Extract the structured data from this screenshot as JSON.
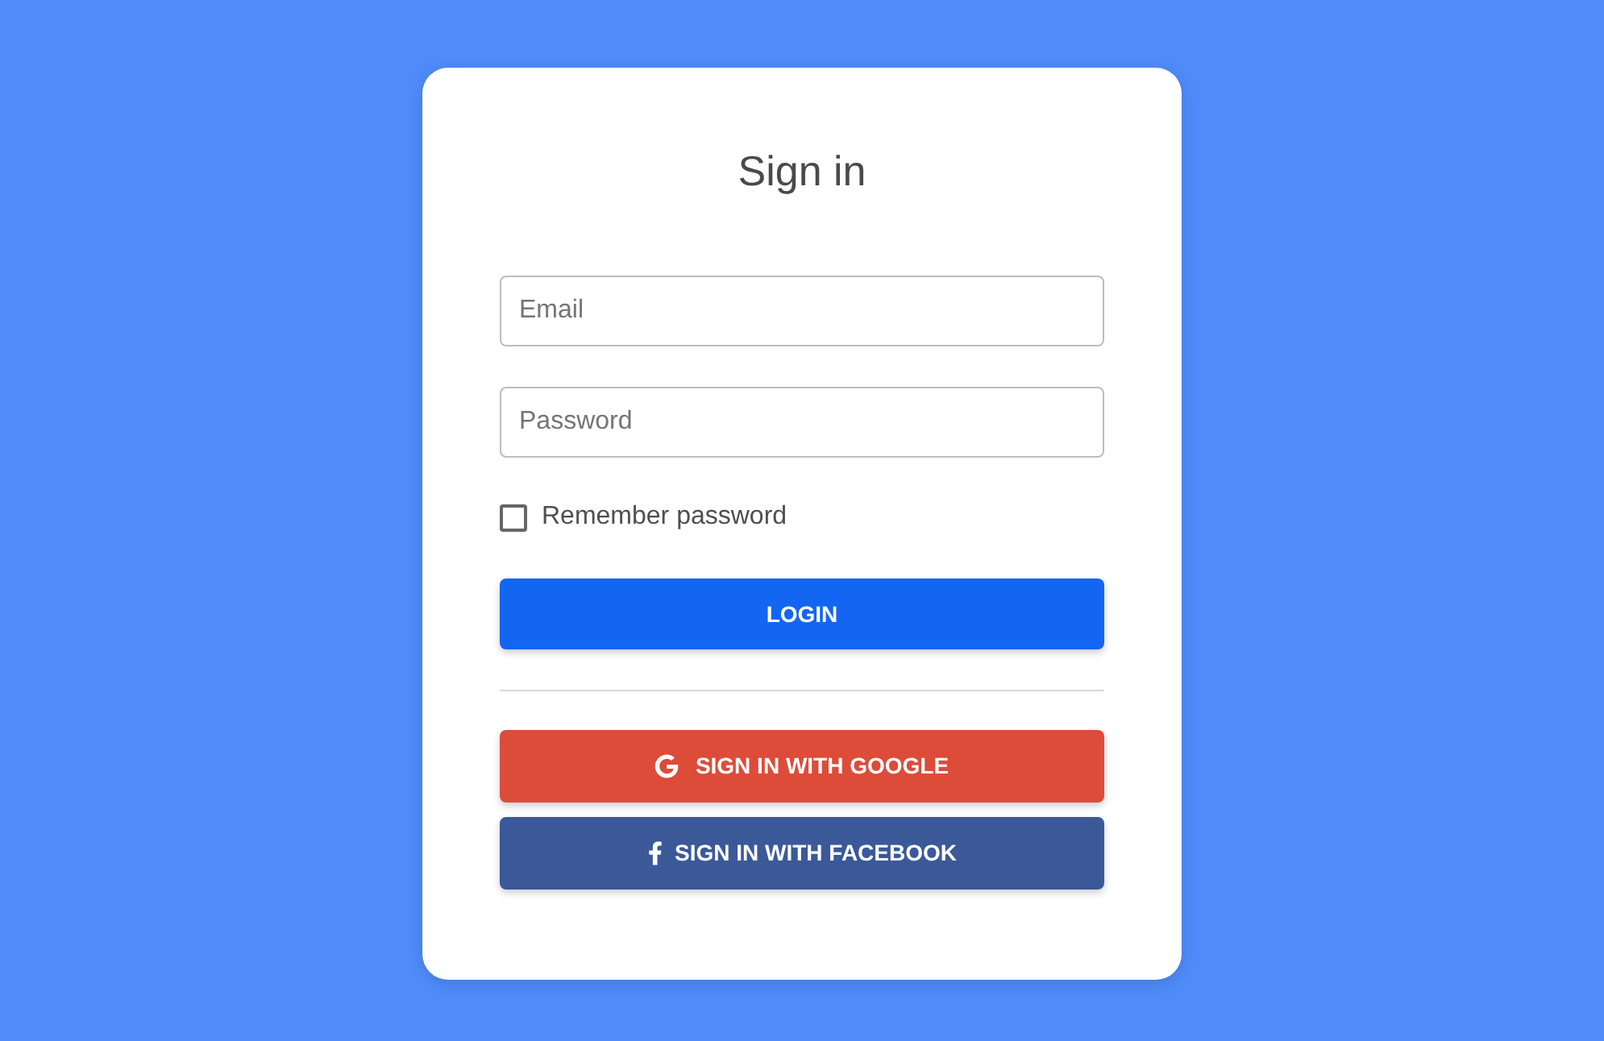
{
  "title": "Sign in",
  "fields": [
    {
      "placeholder": "Email"
    },
    {
      "placeholder": "Password"
    }
  ],
  "remember": {
    "label": "Remember password",
    "checked": false
  },
  "login_button": {
    "label": "LOGIN"
  },
  "social_buttons": [
    {
      "kind": "google",
      "label": "SIGN IN WITH GOOGLE",
      "color": "#dd4b39"
    },
    {
      "kind": "facebook",
      "label": "SIGN IN WITH FACEBOOK",
      "color": "#3b5998"
    }
  ]
}
